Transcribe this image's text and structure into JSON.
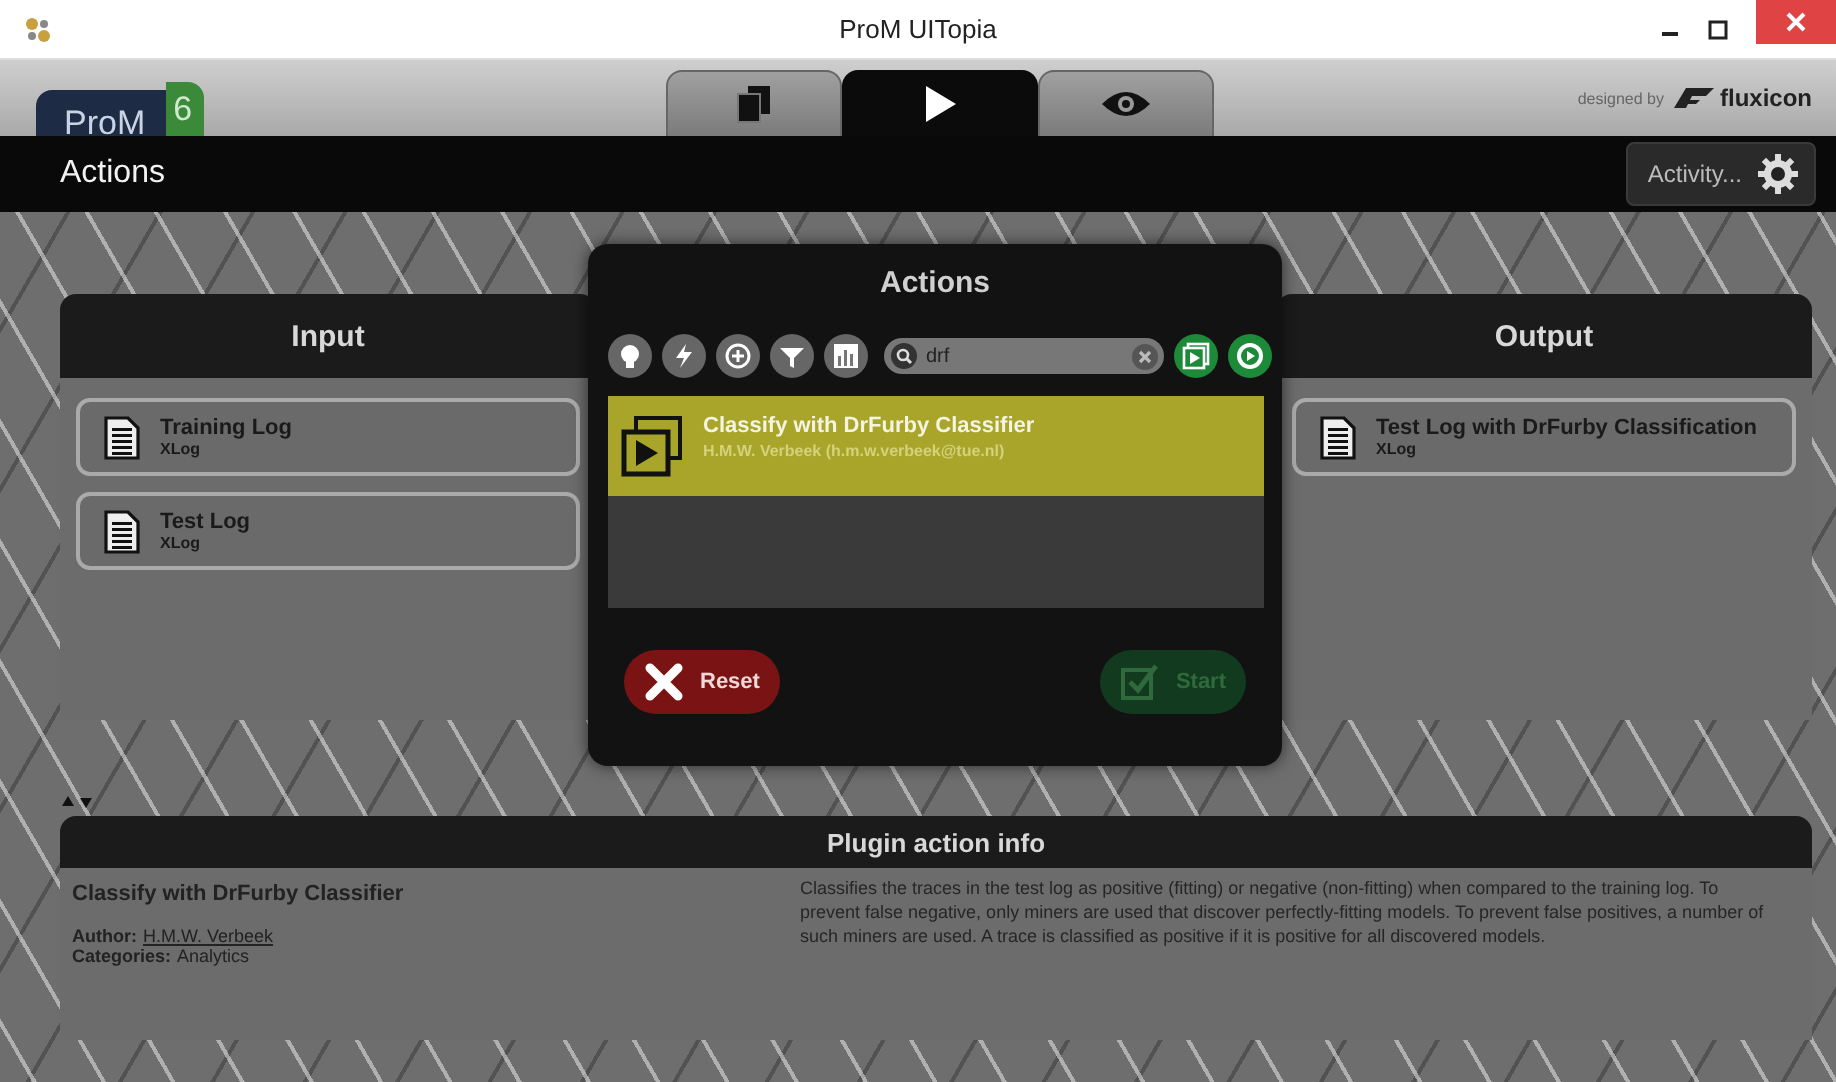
{
  "window": {
    "title": "ProM UITopia"
  },
  "header": {
    "logo": "ProM",
    "logo_version": "6",
    "tabs": [
      {
        "kind": "pages",
        "selected": false
      },
      {
        "kind": "play",
        "selected": true
      },
      {
        "kind": "eye",
        "selected": false
      }
    ],
    "credit": "designed by",
    "brand": "fluxicon"
  },
  "toolbar": {
    "title": "Actions",
    "activity_button": "Activity..."
  },
  "input": {
    "title": "Input",
    "items": [
      {
        "name": "Training Log",
        "type": "XLog"
      },
      {
        "name": "Test Log",
        "type": "XLog"
      }
    ]
  },
  "output": {
    "title": "Output",
    "items": [
      {
        "name": "Test Log with DrFurby Classification",
        "type": "XLog"
      }
    ]
  },
  "actions_dialog": {
    "title": "Actions",
    "search": {
      "value": "drf"
    },
    "results": [
      {
        "name": "Classify with DrFurby Classifier",
        "author": "H.M.W. Verbeek (h.m.w.verbeek@tue.nl)",
        "selected": true
      }
    ],
    "reset_button": {
      "label": "Reset"
    },
    "start_button": {
      "label": "Start",
      "disabled": true
    }
  },
  "info": {
    "title": "Plugin action info",
    "plugin_name": "Classify with DrFurby Classifier",
    "author_label": "Author:",
    "author": "H.M.W. Verbeek",
    "categories_label": "Categories:",
    "categories": "Analytics",
    "description": "Classifies the traces in the test log as positive (fitting) or negative (non-fitting) when compared to the training log. To prevent false negative, only miners are used that discover perfectly-fitting models. To prevent false positives, a number of such miners are used. A trace is classified as positive if it is positive for all discovered models."
  }
}
